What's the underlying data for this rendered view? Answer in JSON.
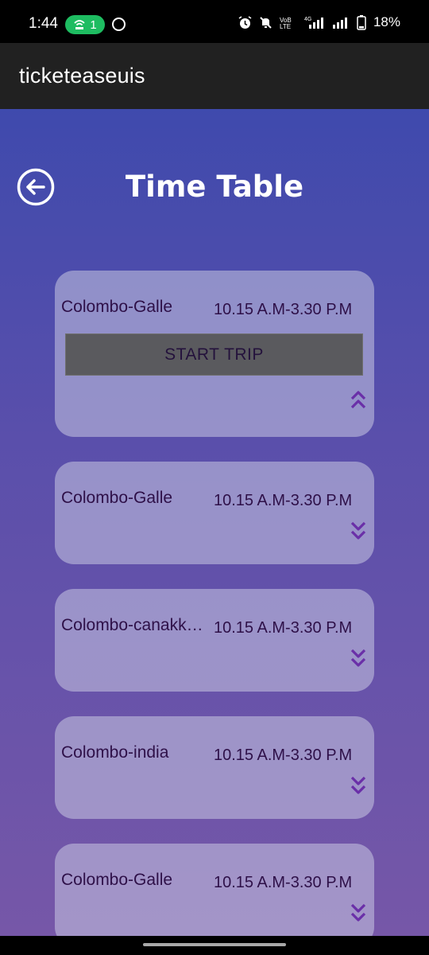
{
  "status_bar": {
    "time": "1:44",
    "hotspot_count": "1",
    "network_label": "VoB LTE",
    "network_type": "4G",
    "battery": "18%"
  },
  "app_bar": {
    "title": "ticketeaseuis"
  },
  "page": {
    "title": "Time Table"
  },
  "trips": [
    {
      "route": "Colombo-Galle",
      "time": "10.15 A.M-3.30 P.M",
      "expanded": true,
      "action_label": "START TRIP"
    },
    {
      "route": "Colombo-Galle",
      "time": "10.15 A.M-3.30 P.M",
      "expanded": false
    },
    {
      "route": "Colombo-canakkale",
      "time": "10.15 A.M-3.30 P.M",
      "expanded": false
    },
    {
      "route": "Colombo-india",
      "time": "10.15 A.M-3.30 P.M",
      "expanded": false
    },
    {
      "route": "Colombo-Galle",
      "time": "10.15 A.M-3.30 P.M",
      "expanded": false
    }
  ],
  "icons": {
    "back": "arrow-left-circle-icon",
    "collapse": "chevron-double-up-icon",
    "expand": "chevron-double-down-icon"
  },
  "colors": {
    "gradient_top": "#3f4aad",
    "gradient_bottom": "#7657a8",
    "card_text": "#2e1048",
    "chevron": "#6a2fa8",
    "button": "#5a5a5e"
  }
}
